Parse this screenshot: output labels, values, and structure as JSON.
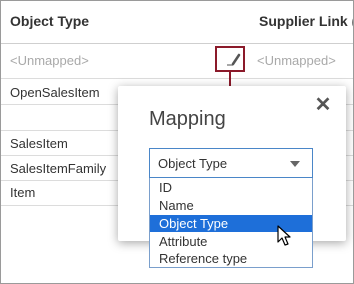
{
  "table": {
    "headers": {
      "object_type": "Object Type",
      "supplier_link": "Supplier Link ("
    },
    "rows": [
      {
        "object_type": "<Unmapped>",
        "supplier_link": "<Unmapped>"
      },
      {
        "object_type": "OpenSalesItem",
        "supplier_link": ""
      },
      {
        "object_type": "",
        "supplier_link": ""
      },
      {
        "object_type": "SalesItem",
        "supplier_link": ""
      },
      {
        "object_type": "SalesItemFamily",
        "supplier_link": ""
      },
      {
        "object_type": "Item",
        "supplier_link": ""
      }
    ]
  },
  "modal": {
    "title": "Mapping",
    "close_label": "✕",
    "select": {
      "value": "Object Type"
    },
    "options": [
      "ID",
      "Name",
      "Object Type",
      "Attribute",
      "Reference type"
    ],
    "selected_option": "Object Type"
  },
  "colors": {
    "accent": "#8b1a2a",
    "selection": "#1e6fd9",
    "select_border": "#4a86c8",
    "unmapped_text": "#a9a9a9"
  },
  "icons": {
    "edit": "pencil-icon",
    "close": "close-icon",
    "caret": "chevron-down-icon",
    "cursor": "mouse-pointer-icon"
  }
}
